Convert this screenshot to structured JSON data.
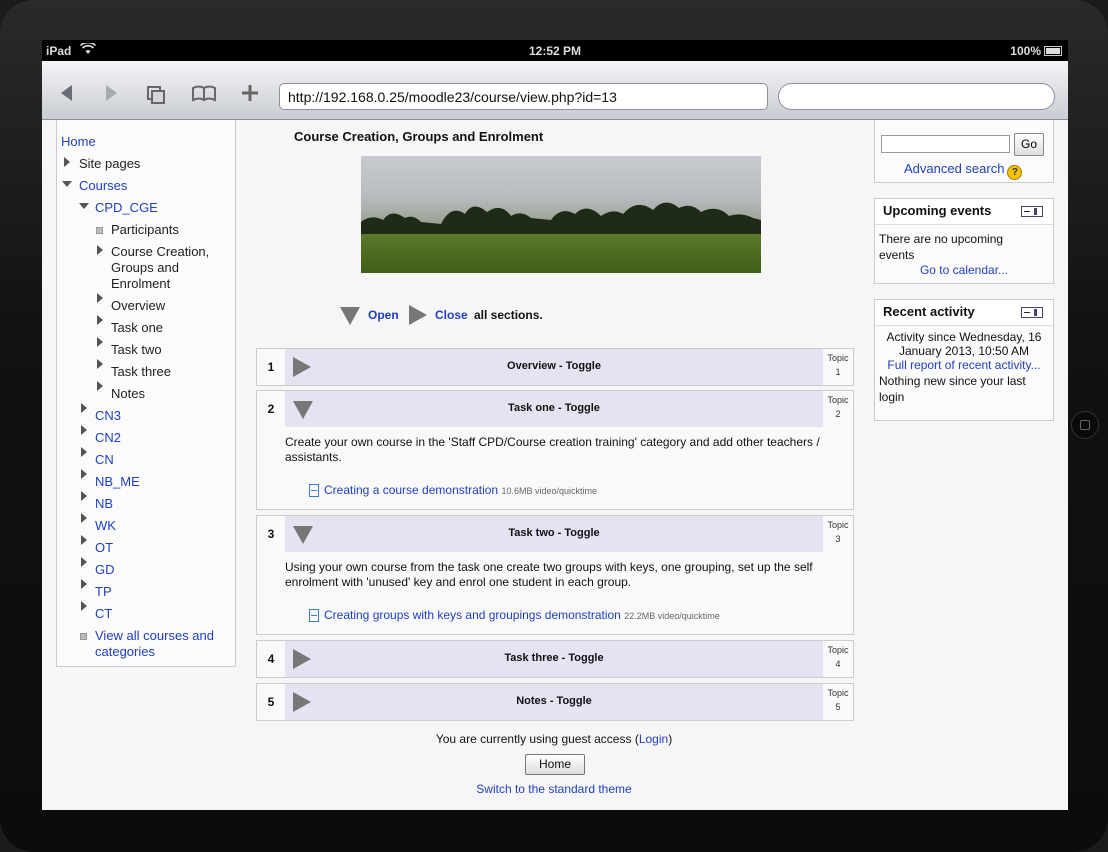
{
  "status_bar": {
    "device": "iPad",
    "time": "12:52 PM",
    "battery": "100%"
  },
  "browser": {
    "url": "http://192.168.0.25/moodle23/course/view.php?id=13",
    "search_placeholder": ""
  },
  "nav": {
    "home": "Home",
    "site_pages": "Site pages",
    "courses": "Courses",
    "current_course": "CPD_CGE",
    "course_children": [
      "Participants",
      "Course Creation, Groups and Enrolment",
      "Overview",
      "Task one",
      "Task two",
      "Task three",
      "Notes"
    ],
    "other_courses": [
      "CN3",
      "CN2",
      "CN",
      "NB_ME",
      "NB",
      "WK",
      "OT",
      "GD",
      "TP",
      "CT"
    ],
    "view_all": "View all courses and categories"
  },
  "main": {
    "title": "Course Creation, Groups and Enrolment",
    "open_label": "Open",
    "close_label": "Close",
    "all_sections": "all sections.",
    "sections": [
      {
        "num": "1",
        "title": "Overview - Toggle",
        "topic": "Topic",
        "topic_num": "1"
      },
      {
        "num": "2",
        "title": "Task one - Toggle",
        "topic": "Topic",
        "topic_num": "2",
        "body": "Create your own course in the 'Staff CPD/Course creation training' category and add other teachers / assistants.",
        "resource": "Creating a course demonstration",
        "resource_meta": "10.6MB video/quicktime"
      },
      {
        "num": "3",
        "title": "Task two - Toggle",
        "topic": "Topic",
        "topic_num": "3",
        "body": "Using your own course from the task one create two groups with keys, one grouping, set up the self enrolment with 'unused' key and enrol one student in each group.",
        "resource": "Creating groups with keys and groupings demonstration",
        "resource_meta": "22.2MB video/quicktime"
      },
      {
        "num": "4",
        "title": "Task three - Toggle",
        "topic": "Topic",
        "topic_num": "4"
      },
      {
        "num": "5",
        "title": "Notes - Toggle",
        "topic": "Topic",
        "topic_num": "5"
      }
    ],
    "guest_text": "You are currently using guest access (",
    "login": "Login",
    "guest_close": ")",
    "home_button": "Home",
    "switch_theme": "Switch to the standard theme"
  },
  "search_block": {
    "go": "Go",
    "advanced": "Advanced search"
  },
  "events_block": {
    "title": "Upcoming events",
    "text": "There are no upcoming events",
    "link": "Go to calendar..."
  },
  "activity_block": {
    "title": "Recent activity",
    "since": "Activity since Wednesday, 16 January 2013, 10:50 AM",
    "link": "Full report of recent activity...",
    "nothing": "Nothing new since your last login"
  }
}
